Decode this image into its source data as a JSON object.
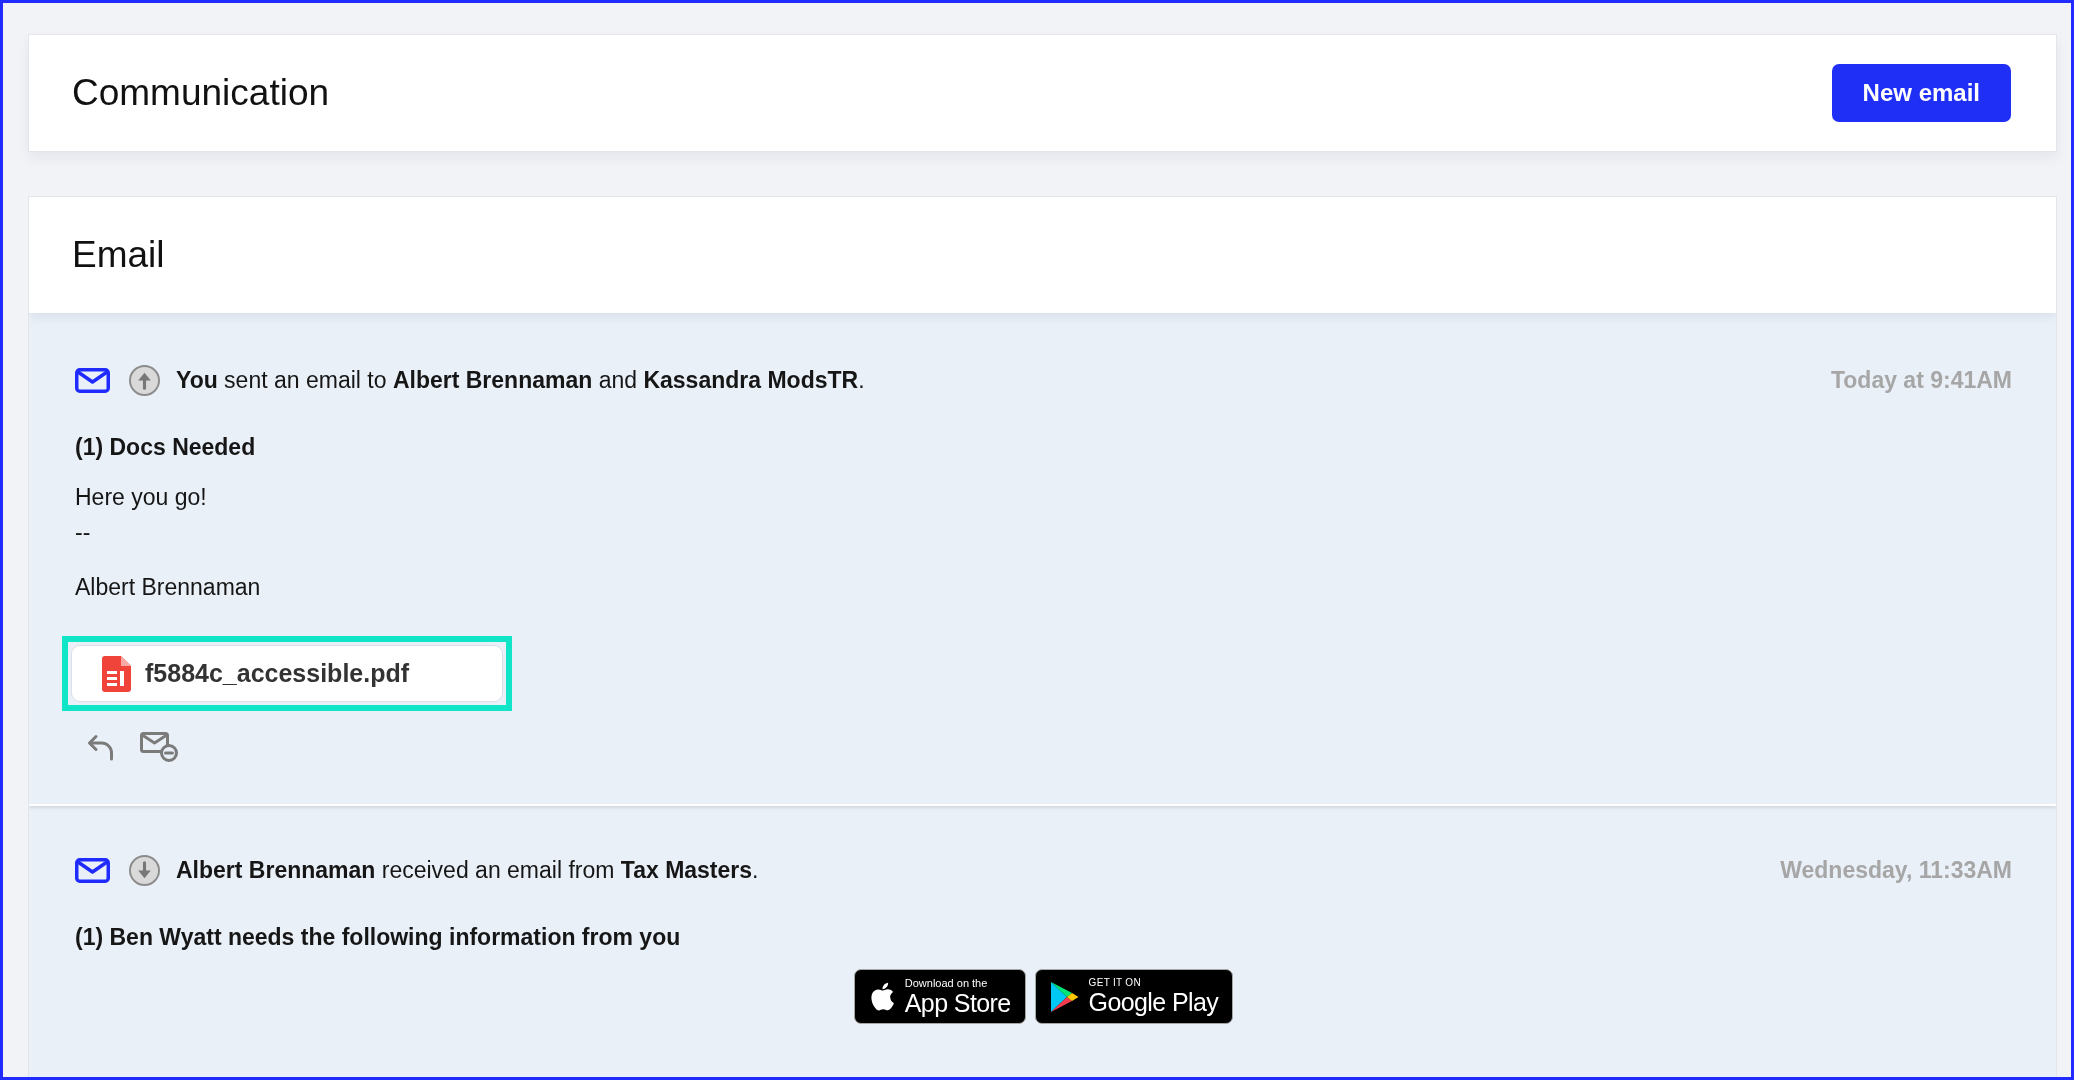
{
  "header": {
    "title": "Communication",
    "new_button": "New email"
  },
  "section": {
    "title": "Email"
  },
  "emails": [
    {
      "outgoing": true,
      "summary": "**You** sent an email to **Albert Brennaman** and **Kassandra ModsTR**.",
      "time": "Today at 9:41AM",
      "subject": "(1) Docs Needed",
      "body": [
        "Here you go!\n--",
        "Albert Brennaman"
      ],
      "attachments": [
        {
          "name": "f5884c_accessible.pdf",
          "highlighted": true
        }
      ],
      "actions": [
        {
          "kind": "reply"
        },
        {
          "kind": "mail_remove"
        }
      ]
    },
    {
      "outgoing": false,
      "summary": "**Albert Brennaman** received an email from **Tax Masters**.",
      "time": "Wednesday, 11:33AM",
      "subject": "(1) Ben Wyatt needs the following information from you",
      "store_badges": [
        {
          "kind": "apple",
          "caption": "Download on the",
          "name": "App Store"
        },
        {
          "kind": "google",
          "caption": "GET IT ON",
          "name": "Google Play"
        }
      ]
    }
  ]
}
